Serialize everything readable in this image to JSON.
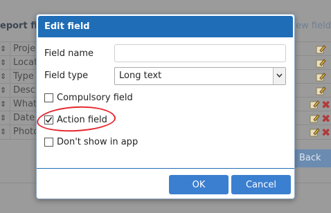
{
  "background": {
    "title": "eport fie",
    "new_field": "ew field",
    "rows": [
      "Proje",
      "Locat",
      "Type",
      "Descr",
      "What",
      "Date",
      "Photo"
    ],
    "back_label": "Back"
  },
  "dialog": {
    "title": "Edit field",
    "field_name_label": "Field name",
    "field_name_value": "",
    "field_type_label": "Field type",
    "field_type_value": "Long text",
    "compulsory_label": "Compulsory field",
    "compulsory_checked": false,
    "action_label": "Action field",
    "action_checked": true,
    "dont_show_label": "Don't show in app",
    "dont_show_checked": false,
    "ok_label": "OK",
    "cancel_label": "Cancel"
  },
  "colors": {
    "header": "#1f6db6",
    "button": "#3b7fd0",
    "annotation": "#e5262d"
  }
}
